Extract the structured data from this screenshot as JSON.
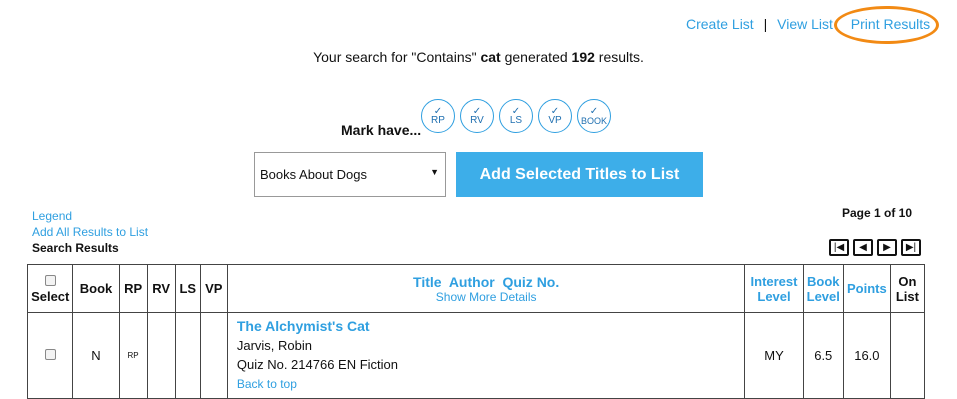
{
  "top_links": {
    "create_list": "Create List",
    "separator": "|",
    "view_list": "View List",
    "print_results": "Print Results"
  },
  "highlight_color": "#f28a14",
  "summary": {
    "prefix": "Your search for \"Contains\" ",
    "term": "cat",
    "middle": " generated ",
    "count": "192",
    "suffix": " results."
  },
  "mark_have": {
    "label": "Mark have...",
    "icons": [
      {
        "check": "✓",
        "label": "RP"
      },
      {
        "check": "✓",
        "label": "RV"
      },
      {
        "check": "✓",
        "label": "LS"
      },
      {
        "check": "✓",
        "label": "VP"
      },
      {
        "check": "✓",
        "label": "BOOK"
      }
    ]
  },
  "list_select": {
    "selected": "Books About Dogs"
  },
  "add_button": "Add Selected Titles to List",
  "left_links": {
    "legend": "Legend",
    "add_all": "Add All Results to List",
    "search_results": "Search Results"
  },
  "pagination": {
    "page_info": "Page 1 of 10",
    "icons": [
      "first-page-icon",
      "prev-page-icon",
      "next-page-icon",
      "last-page-icon"
    ]
  },
  "table": {
    "headers": {
      "select": "Select",
      "book": "Book",
      "rp": "RP",
      "rv": "RV",
      "ls": "LS",
      "vp": "VP",
      "title_author_quiz": "Title  Author  Quiz No.",
      "show_more": "Show More Details",
      "interest_level": "Interest Level",
      "book_level": "Book Level",
      "points": "Points",
      "on_list": "On List"
    },
    "rows": [
      {
        "book": "N",
        "rp": "RP",
        "rv": "",
        "ls": "",
        "vp": "",
        "title": "The Alchymist's Cat",
        "author": "Jarvis, Robin",
        "quiz": "Quiz No. 214766 EN Fiction",
        "back_to_top": "Back to top",
        "interest_level": "MY",
        "book_level": "6.5",
        "points": "16.0",
        "on_list": ""
      }
    ]
  },
  "accent_color": "#2f9fe0",
  "button_color": "#3daee9"
}
